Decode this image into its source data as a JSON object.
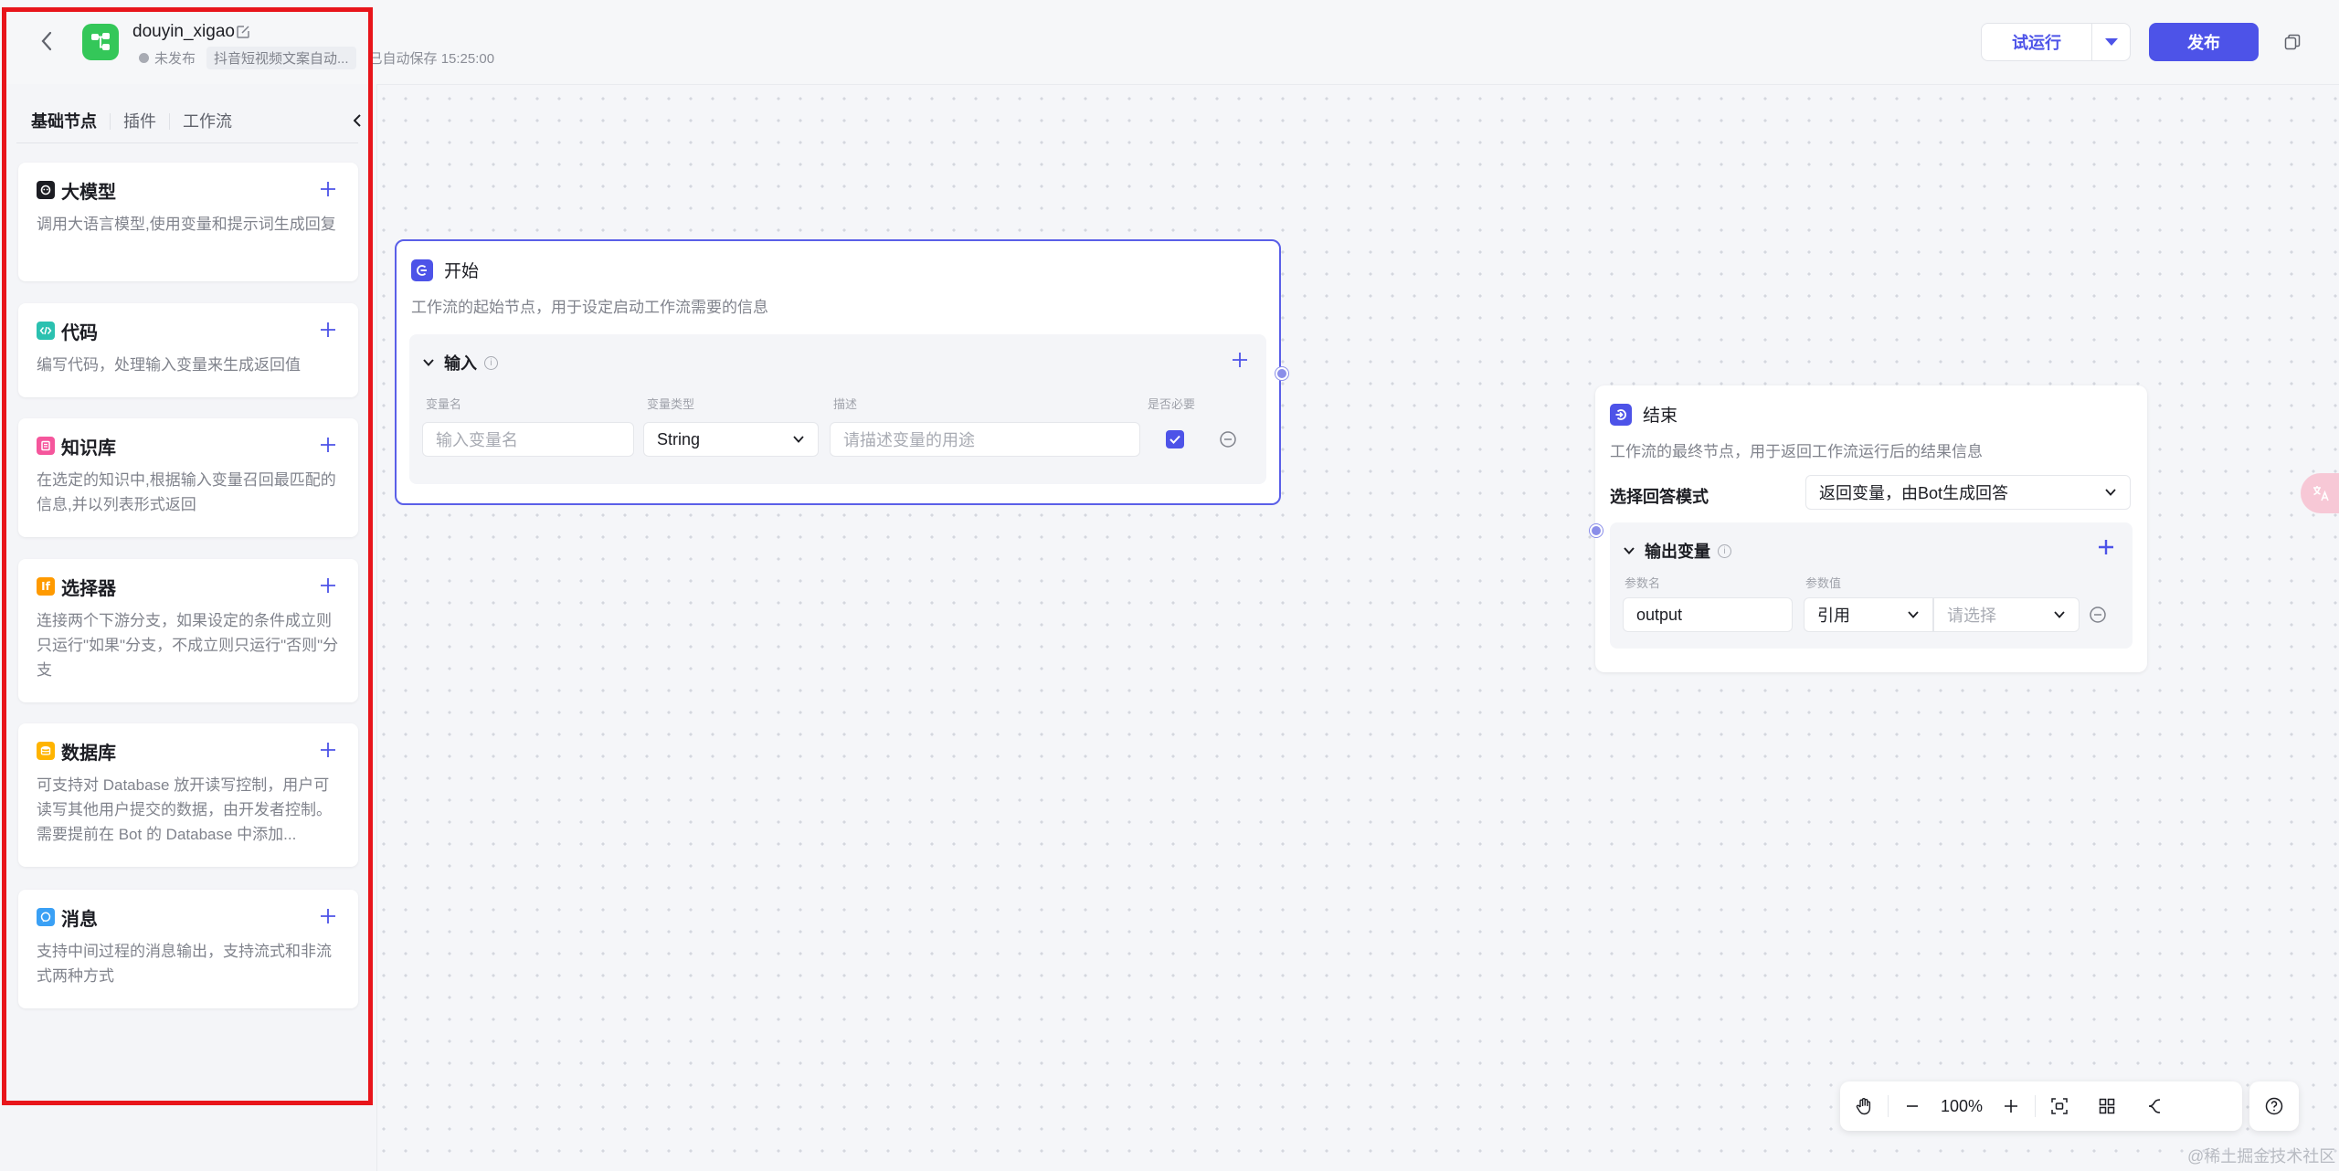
{
  "header": {
    "app_name": "douyin_xigao",
    "status": "未发布",
    "description": "抖音短视频文案自动...",
    "autosave": "已自动保存 15:25:00",
    "trial_run_label": "试运行",
    "publish_label": "发布",
    "accent_color": "#4d53e8"
  },
  "left_panel": {
    "tabs": [
      {
        "label": "基础节点",
        "active": true
      },
      {
        "label": "插件",
        "active": false
      },
      {
        "label": "工作流",
        "active": false
      }
    ],
    "nodes": [
      {
        "title": "大模型",
        "description": "调用大语言模型,使用变量和提示词生成回复",
        "icon": "llm-icon",
        "icon_color": "#1c1d23"
      },
      {
        "title": "代码",
        "description": "编写代码，处理输入变量来生成返回值",
        "icon": "code-icon",
        "icon_color": "#2bc1b0"
      },
      {
        "title": "知识库",
        "description": "在选定的知识中,根据输入变量召回最匹配的信息,并以列表形式返回",
        "icon": "knowledge-icon",
        "icon_color": "#f5569c"
      },
      {
        "title": "选择器",
        "description": "连接两个下游分支，如果设定的条件成立则只运行\"如果\"分支，不成立则只运行\"否则\"分支",
        "icon": "condition-icon",
        "icon_color": "#ff9a00"
      },
      {
        "title": "数据库",
        "description": "可支持对 Database 放开读写控制，用户可读写其他用户提交的数据，由开发者控制。需要提前在 Bot 的 Database 中添加...",
        "icon": "database-icon",
        "icon_color": "#ffb400"
      },
      {
        "title": "消息",
        "description": "支持中间过程的消息输出，支持流式和非流式两种方式",
        "icon": "message-icon",
        "icon_color": "#3aa0f5"
      }
    ]
  },
  "start_node": {
    "title": "开始",
    "description": "工作流的起始节点，用于设定启动工作流需要的信息",
    "section_title": "输入",
    "columns": [
      "变量名",
      "变量类型",
      "描述",
      "是否必要"
    ],
    "row": {
      "name_placeholder": "输入变量名",
      "type_value": "String",
      "desc_placeholder": "请描述变量的用途",
      "required": true
    }
  },
  "end_node": {
    "title": "结束",
    "description": "工作流的最终节点，用于返回工作流运行后的结果信息",
    "mode_label": "选择回答模式",
    "mode_value": "返回变量，由Bot生成回答",
    "section_title": "输出变量",
    "columns": [
      "参数名",
      "参数值"
    ],
    "row": {
      "name_value": "output",
      "ref_value": "引用",
      "select_placeholder": "请选择"
    }
  },
  "toolbar": {
    "zoom": "100%"
  },
  "watermark": "@稀土掘金技术社区"
}
